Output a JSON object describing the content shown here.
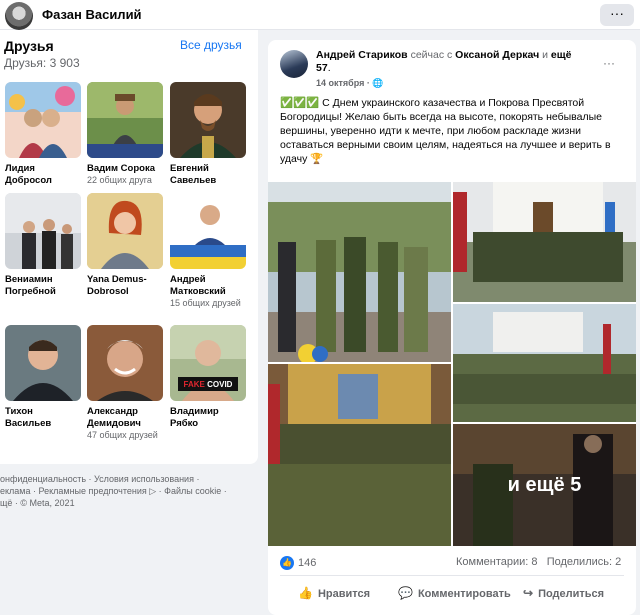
{
  "header": {
    "name": "Фазан Василий",
    "more": "···"
  },
  "friends": {
    "title": "Друзья",
    "see_all": "Все друзья",
    "count": "Друзья: 3 903",
    "items": [
      {
        "name": "Лидия Добросол",
        "mutual": ""
      },
      {
        "name": "Вадим Сорока",
        "mutual": "22 общих друга"
      },
      {
        "name": "Евгений Савельев",
        "mutual": ""
      },
      {
        "name": "Вениамин Погребной",
        "mutual": ""
      },
      {
        "name": "Yana Demus-Dobrosol",
        "mutual": ""
      },
      {
        "name": "Андрей Матковский",
        "mutual": "15 общих друзей"
      },
      {
        "name": "Тихон Васильев",
        "mutual": ""
      },
      {
        "name": "Александр Демидович",
        "mutual": "47 общих друзей"
      },
      {
        "name": "Владимир Рябко",
        "mutual": ""
      }
    ],
    "fake_label": "FAKE COVID"
  },
  "footer": {
    "line1": "онфиденциальность · Условия использования ·",
    "line2": "еклама · Рекламные предпочтения ▷ · Файлы cookie ·",
    "line3": "щё · © Meta, 2021"
  },
  "post": {
    "author": "Андрей Стариков",
    "with_text": "сейчас с",
    "tagged": "Оксаной Деркач",
    "and_text": "и",
    "others": "ещё 57",
    "date": "14 октября · ",
    "more": "···",
    "emoji": "✅✅✅",
    "text": "С Днем украинского казачества и Покрова Пресвятой Богородицы! Желаю быть всегда на высоте, покорять небывалые вершины, уверенно идти к мечте, при любом раскладе жизни оставаться верными своим целям, надеяться на лучшее и верить в удачу",
    "more_photos": "и ещё 5",
    "likes": "146",
    "comments": "Комментарии: 8",
    "shares": "Поделились: 2",
    "actions": {
      "like": "Нравится",
      "comment": "Комментировать",
      "share": "Поделиться"
    }
  }
}
